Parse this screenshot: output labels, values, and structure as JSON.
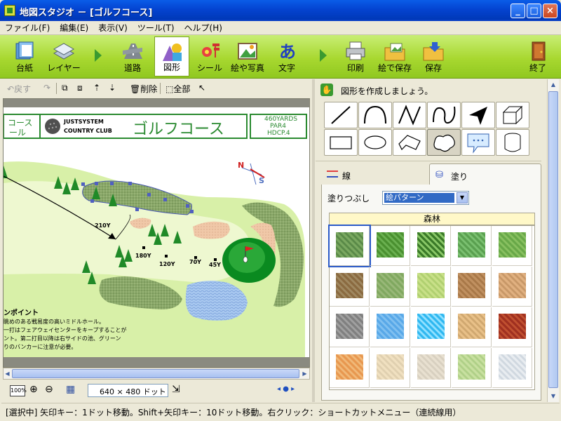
{
  "window": {
    "title": "地図スタジオ － [ゴルフコース]",
    "buttons": [
      "_",
      "□",
      "×"
    ]
  },
  "menu": [
    "ファイル(F)",
    "編集(E)",
    "表示(V)",
    "ツール(T)",
    "ヘルプ(H)"
  ],
  "toolbar": {
    "items": [
      "台紙",
      "レイヤー",
      "道路",
      "図形",
      "シール",
      "絵や写真",
      "文字",
      "印刷",
      "絵で保存",
      "保存",
      "終了"
    ],
    "active": "図形"
  },
  "edit_toolbar": {
    "back": "戻す",
    "delete": "削除",
    "all": "全部"
  },
  "canvas": {
    "header_left_1": "コース",
    "header_left_2": "ール",
    "club_line1": "JUSTSYSTEM",
    "club_line2": "COUNTRY CLUB",
    "course_title": "ゴルフコース",
    "info": [
      "460YARDS",
      "PAR4",
      "HDCP.4"
    ],
    "distance_labels": [
      "210Y",
      "180Y",
      "120Y",
      "70Y",
      "45Y"
    ],
    "compass_n": "N",
    "compass_s": "S",
    "point_title": "ンポイント",
    "point_text": [
      "眺めのある戦易度の高いミドルホール。",
      "一打はフェアウェイセンターをキープすることが",
      "ント。第二打目以降は右サイドの池、グリーン",
      "りのバンカーに注意が必要。"
    ]
  },
  "bottom_bar": {
    "zoom_button": "100%",
    "size": "640 × 480 ドット"
  },
  "panel": {
    "instruction": "図形を作成しましょう。",
    "tabs": [
      "線",
      "塗り"
    ],
    "active_tab": "塗り",
    "fill_label": "塗りつぶし",
    "fill_value": "絵パターン",
    "category": "森林",
    "swatch_count": 20
  },
  "status_text": "[選択中] 矢印キー：1ドット移動。Shift+矢印キー：10ドット移動。右クリック：ショートカットメニュー（連続線用）",
  "colors": {
    "titlebar": "#0a5de8",
    "toolbar": "#a8d830",
    "category_bar": "#fff8c8",
    "grass": "#3a9a30"
  }
}
